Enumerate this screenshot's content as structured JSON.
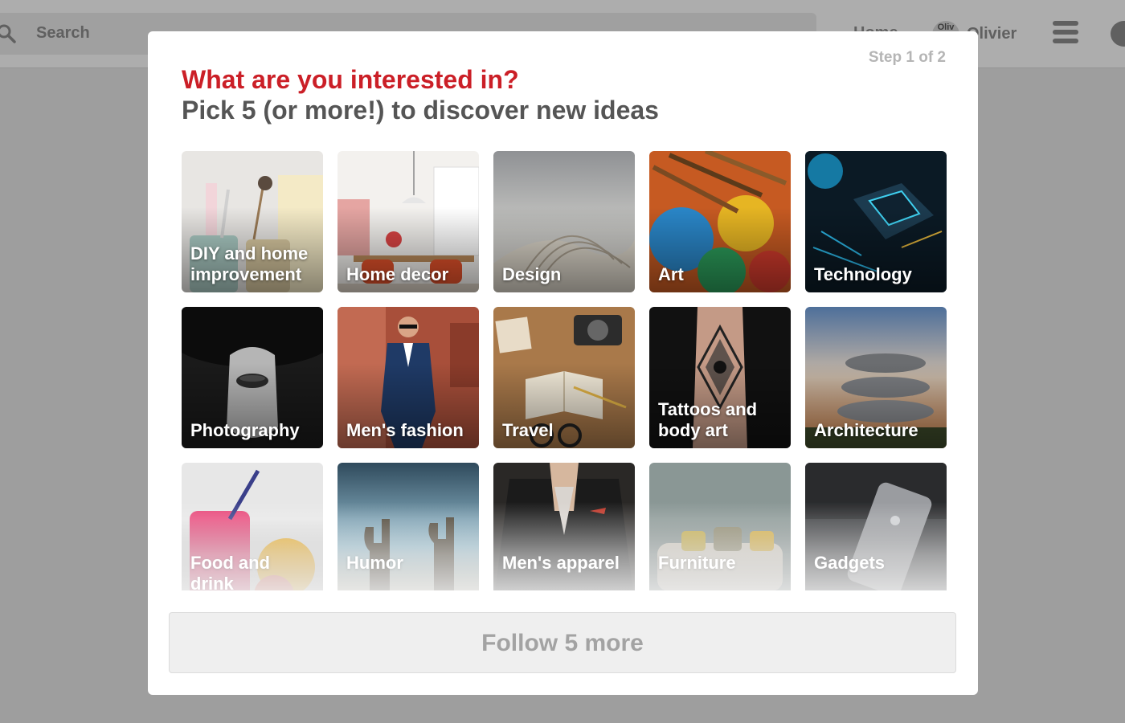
{
  "app": {
    "search": {
      "placeholder": "Search",
      "icon": "search-icon"
    },
    "nav": {
      "home_label": "Home"
    },
    "user": {
      "avatar_text": "Oliv",
      "name": "Olivier"
    },
    "menu_icon": "menu-icon",
    "chat_icon": "chat-icon"
  },
  "modal": {
    "step": "Step 1 of 2",
    "title": "What are you interested in?",
    "subtitle": "Pick 5 (or more!) to discover new ideas",
    "colors": {
      "title": "#cb1f27",
      "subtitle": "#555555",
      "button_text": "#a3a3a3"
    },
    "topics": [
      {
        "label": "DIY and home improvement"
      },
      {
        "label": "Home decor"
      },
      {
        "label": "Design"
      },
      {
        "label": "Art"
      },
      {
        "label": "Technology"
      },
      {
        "label": "Photography"
      },
      {
        "label": "Men's fashion"
      },
      {
        "label": "Travel"
      },
      {
        "label": "Tattoos and body art"
      },
      {
        "label": "Architecture"
      },
      {
        "label": "Food and drink"
      },
      {
        "label": "Humor"
      },
      {
        "label": "Men's apparel"
      },
      {
        "label": "Furniture"
      },
      {
        "label": "Gadgets"
      }
    ],
    "follow_button": "Follow 5 more"
  }
}
